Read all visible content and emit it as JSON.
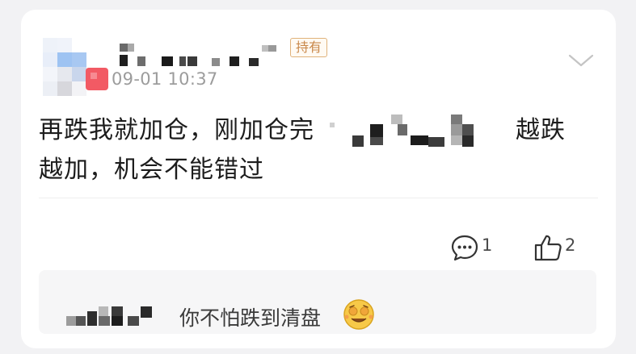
{
  "post": {
    "badge": "持有",
    "time": "09-01 10:37",
    "line1": "再跌我就加仓，刚加仓完",
    "line1_tail": "越跌",
    "line2": "越加，机会不能错过"
  },
  "actions": {
    "comment_icon": "comment-bubble-icon",
    "comment_count": "1",
    "like_icon": "thumbs-up-icon",
    "like_count": "2",
    "more_icon": "chevron-down-icon"
  },
  "reply": {
    "text": "你不怕跌到清盘",
    "emoji": "money-eyes-emoji-icon"
  },
  "colors": {
    "badge_border": "#e0b27a",
    "badge_text": "#c9884a",
    "time_text": "#9c9c9c",
    "reply_bg": "#f6f6f7"
  }
}
